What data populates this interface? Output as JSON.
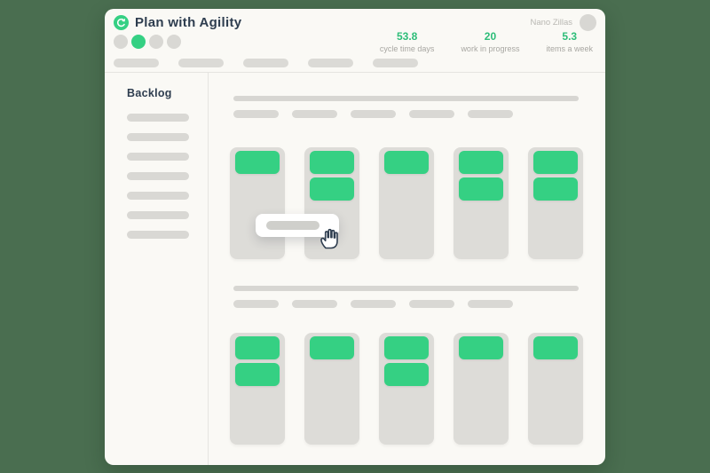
{
  "header": {
    "title": "Plan with Agility",
    "logo_icon": "cycle-icon",
    "user": {
      "name": "Nano Zillas",
      "avatar_icon": "avatar-circle"
    },
    "progress_dots": {
      "count": 4,
      "active_index": 1
    },
    "stats": [
      {
        "value": "53.8",
        "label": "cycle time days"
      },
      {
        "value": "20",
        "label": "work in progress"
      },
      {
        "value": "5.3",
        "label": "items a week"
      }
    ],
    "nav_placeholder_count": 5
  },
  "sidebar": {
    "title": "Backlog",
    "placeholder_item_count": 7
  },
  "board": {
    "sections": [
      {
        "header_pill_count": 5,
        "column_green_card_counts": [
          1,
          2,
          1,
          2,
          2
        ]
      },
      {
        "header_pill_count": 5,
        "column_green_card_counts": [
          2,
          1,
          2,
          1,
          1
        ]
      }
    ]
  },
  "drag_card": {
    "cursor_icon": "grab-hand-icon",
    "placeholder_pill": true
  },
  "colors": {
    "outer_background": "#4a6e50",
    "window_background": "#faf9f5",
    "accent_green": "#35d083",
    "stat_green": "#2dbd78",
    "placeholder_gray": "#d9d8d4",
    "text_dark": "#2e3d4f",
    "text_muted": "#a8a7a2"
  }
}
